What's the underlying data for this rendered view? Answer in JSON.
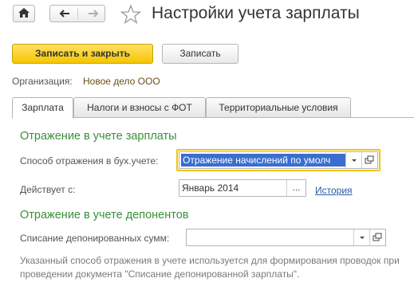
{
  "window": {
    "title": "Настройки учета зарплаты"
  },
  "nav": {
    "home_icon": "home-icon",
    "back_icon": "arrow-left-icon",
    "forward_icon": "arrow-right-icon",
    "favorite_icon": "star-icon"
  },
  "toolbar": {
    "save_close_label": "Записать и закрыть",
    "save_label": "Записать"
  },
  "organization": {
    "label": "Организация:",
    "value": "Новое дело ООО"
  },
  "tabs": [
    {
      "label": "Зарплата",
      "active": true
    },
    {
      "label": "Налоги и взносы с ФОТ",
      "active": false
    },
    {
      "label": "Территориальные условия",
      "active": false
    }
  ],
  "salary_section": {
    "heading": "Отражение в учете зарплаты",
    "method_label": "Способ отражения в бух.учете:",
    "method_value": "Отражение начислений по умолч",
    "effective_label": "Действует с:",
    "effective_value": "Январь 2014",
    "history_link": "История"
  },
  "deposit_section": {
    "heading": "Отражение в учете депонентов",
    "writeoff_label": "Списание депонированных сумм:",
    "writeoff_value": ""
  },
  "note": "Указанный способ отражения в учете используется для формирования проводок при проведении документа \"Списание депонированной зарплаты\".",
  "colors": {
    "accent_green": "#3a8f3a",
    "primary_button": "#f5c500",
    "focus_border": "#f2c500",
    "selection": "#3a6ecf",
    "link": "#2a5ba8"
  }
}
